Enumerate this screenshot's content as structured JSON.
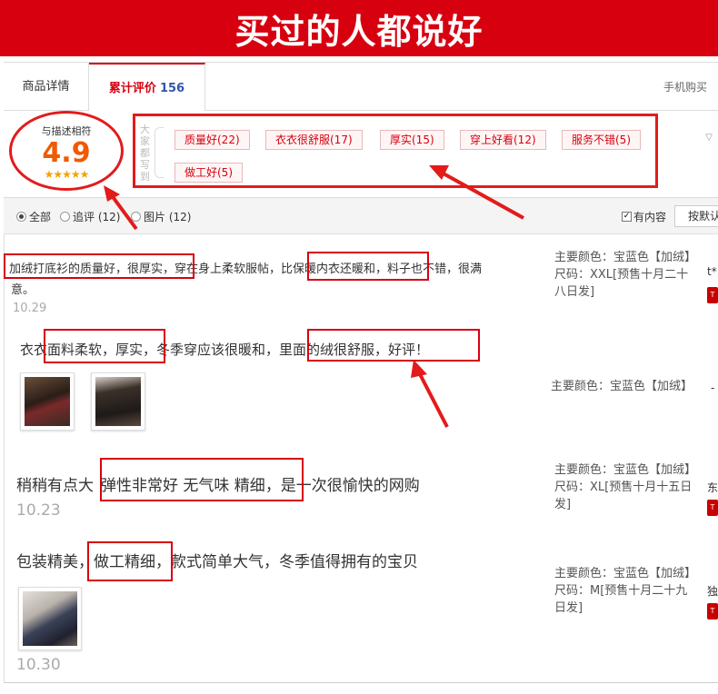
{
  "banner": {
    "title": "买过的人都说好"
  },
  "tabs": {
    "detail": "商品详情",
    "reviews": "累计评价",
    "reviews_count": "156",
    "mobile": "手机购买"
  },
  "summary": {
    "score_label": "与描述相符",
    "score": "4.9",
    "stars": "★★★★★",
    "side_label": "大家都写到",
    "tags": [
      "质量好(22)",
      "衣衣很舒服(17)",
      "厚实(15)",
      "穿上好看(12)",
      "服务不错(5)",
      "做工好(5)"
    ],
    "chevron": "▽"
  },
  "filters": {
    "all": "全部",
    "followup": "追评 (12)",
    "images": "图片 (12)",
    "has_content": "有内容",
    "sort": "按默认"
  },
  "reviews": [
    {
      "text_line1_a": "加绒打底衫的质量好，很厚实，",
      "text_line1_b": "穿在身上柔软服帖，",
      "text_line1_c": "比保暖内衣还暖和，",
      "text_line1_d": "料子也不错，很满",
      "text_line2": "意。",
      "date": "10.29",
      "meta_color": "主要颜色：宝蓝色【加绒】",
      "meta_size": "尺码：XXL[预售十月二十八日发]",
      "user": "t*"
    },
    {
      "text_a": "衣衣面料柔软，厚实，",
      "text_b": "冬季穿应该很暖和，",
      "text_c": "里面的绒很舒服，",
      "text_d": "好评！",
      "meta_color": "主要颜色：宝蓝色【加绒】",
      "user": "-"
    },
    {
      "text_a": "稍稍有点大",
      "text_b": "弹性非常好 无气味 精细",
      "text_c": "，是一次很愉快的网购",
      "date": "10.23",
      "meta_color": "主要颜色：宝蓝色【加绒】",
      "meta_size": "尺码：XL[预售十月十五日发]",
      "user": "东"
    },
    {
      "text_a": "包装精美",
      "text_b": "，做工精细",
      "text_c": "，款式简单大气，冬季值得拥有的宝贝",
      "date": "10.30",
      "meta_color": "主要颜色：宝蓝色【加绒】",
      "meta_size": "尺码：M[预售十月二十九日发]",
      "user": "独"
    }
  ],
  "badge_text": "T",
  "colors": {
    "brand_red": "#d7000f",
    "score_orange": "#f05a00",
    "star": "#f7a200",
    "count_blue": "#3355aa"
  }
}
